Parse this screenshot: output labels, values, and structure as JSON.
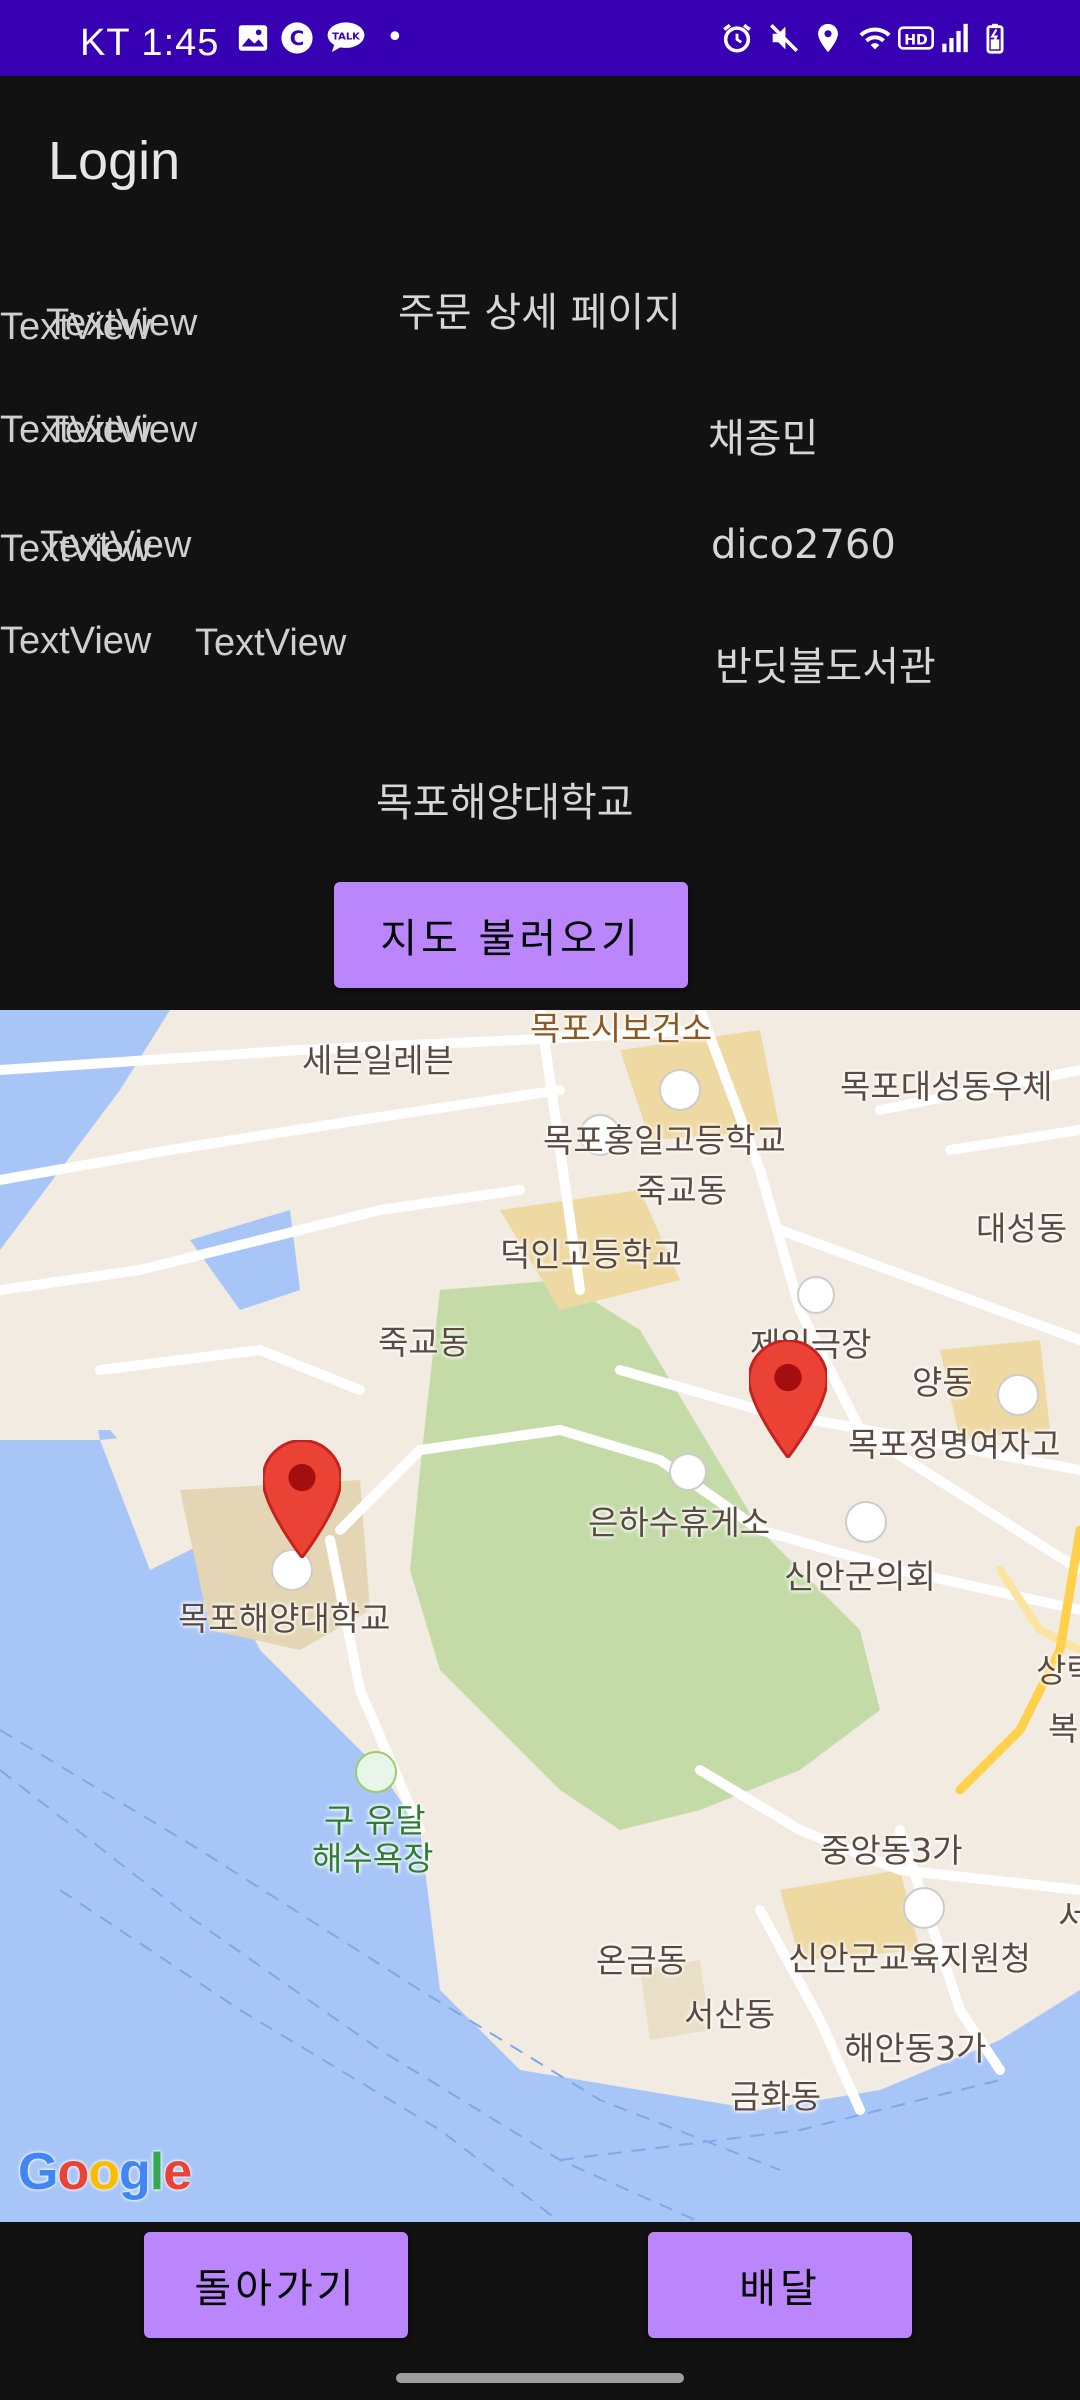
{
  "status_bar": {
    "carrier_time": "KT 1:45",
    "dot": "•",
    "left_icons": [
      "image-icon",
      "c-icon",
      "talk-icon"
    ],
    "right_icons": [
      "alarm-icon",
      "mute-icon",
      "location-icon",
      "wifi-icon",
      "hd-icon",
      "signal-icon",
      "battery-icon"
    ],
    "color": "#3700b3"
  },
  "app_bar": {
    "title": "Login"
  },
  "content": {
    "page_heading": "주문 상세 페이지",
    "textview_label": "TextView",
    "name_value": "채종민",
    "id_value": "dico2760",
    "store_value": "반딧불도서관",
    "destination_value": "목포해양대학교",
    "load_map_button": "지도 불러오기"
  },
  "map": {
    "labels": {
      "seven_eleven": "세븐일레븐",
      "health_center": "목포시보건소",
      "daeseong_post": "목포대성동우체",
      "hongil_high": "목포홍일고등학교",
      "jukgyo_dong_1": "죽교동",
      "deokin_high": "덕인고등학교",
      "daeseong_dong": "대성동",
      "jukgyo_dong_2": "죽교동",
      "jeil_theater": "제일극장",
      "yang_dong": "양동",
      "jeongmyeong": "목포정명여자고",
      "eunha_rest": "은하수휴게소",
      "shinan_council": "신안군의회",
      "univ": "목포해양대학교",
      "sang": "상락",
      "bok": "복",
      "yudal_1": "구 유달",
      "yudal_2": "해수욕장",
      "jungang": "중앙동3가",
      "seo": "서",
      "eungeum": "온금동",
      "shinan_edu": "신안군교육지원청",
      "seosan": "서산동",
      "haean": "해안동3가",
      "geumhwa": "금화동"
    },
    "google_logo": "Google",
    "pin_color": "#ea4335",
    "colors": {
      "land": "#f1ebe1",
      "water": "#a7c6f7",
      "park": "#c4dba8",
      "roads": "#ffffff"
    }
  },
  "bottom": {
    "back_button": "돌아가기",
    "delivery_button": "배달",
    "accent": "#bb86fc"
  }
}
